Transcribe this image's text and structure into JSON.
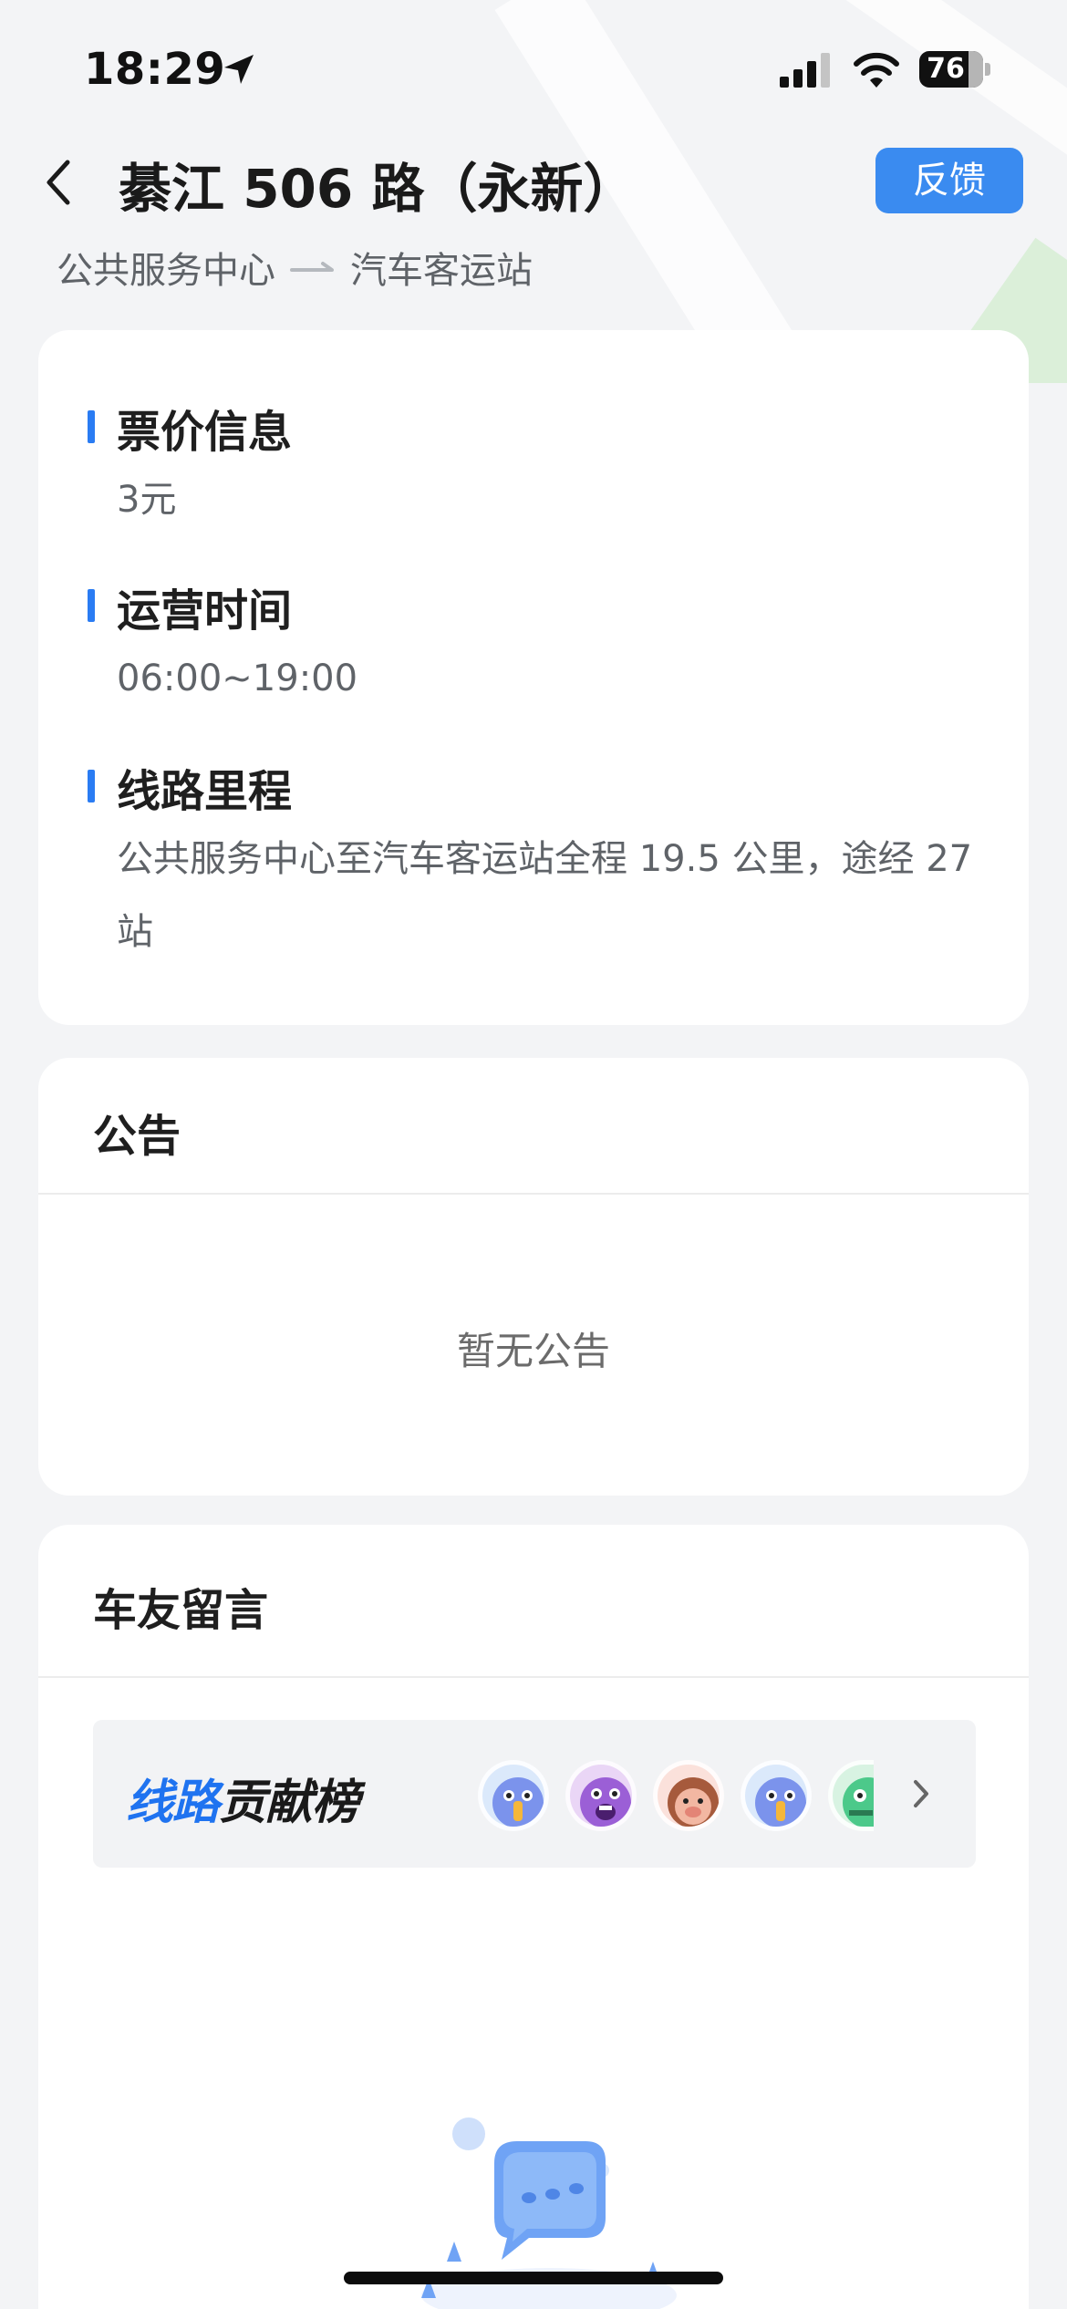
{
  "status_bar": {
    "time": "18:29",
    "battery_level": "76"
  },
  "header": {
    "route_title": "綦江 506 路（永新）",
    "feedback_label": "反馈",
    "from_station": "公共服务中心",
    "to_station": "汽车客运站"
  },
  "info": {
    "fare_heading": "票价信息",
    "fare_value": "3元",
    "hours_heading": "运营时间",
    "hours_value": "06:00~19:00",
    "mileage_heading": "线路里程",
    "mileage_value": "公共服务中心至汽车客运站全程 19.5 公里，途经 27站"
  },
  "notice": {
    "heading": "公告",
    "empty_text": "暂无公告"
  },
  "comments": {
    "heading": "车友留言",
    "leaderboard_title_part1": "线路",
    "leaderboard_title_part2": "贡献榜"
  },
  "colors": {
    "accent": "#3a8bf0",
    "section_bar": "#2a7cf3",
    "background": "#f3f4f6"
  }
}
